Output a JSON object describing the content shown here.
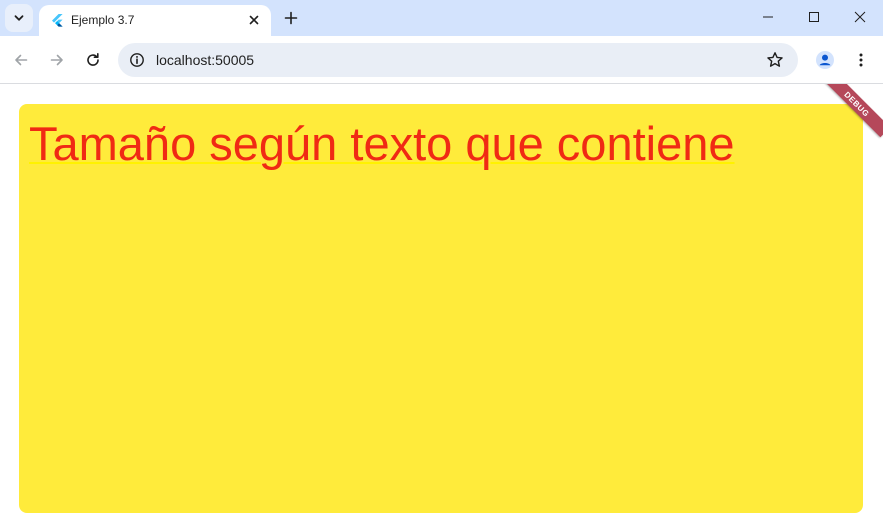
{
  "browser": {
    "tab": {
      "title": "Ejemplo 3.7"
    },
    "address_bar": {
      "url": "localhost:50005"
    },
    "icons": {
      "tab_search": "chevron-down-icon",
      "favicon": "flutter-icon",
      "close_tab": "close-icon",
      "new_tab": "plus-icon",
      "minimize": "minimize-icon",
      "maximize": "maximize-icon",
      "close_window": "close-icon",
      "back": "arrow-left-icon",
      "forward": "arrow-right-icon",
      "reload": "reload-icon",
      "site_info": "info-icon",
      "bookmark": "star-icon",
      "profile": "person-icon",
      "menu": "more-vert-icon"
    },
    "colors": {
      "tabstrip_bg": "#d3e3fd",
      "omnibox_bg": "#e9eef6"
    }
  },
  "page": {
    "box_text": "Tamaño según texto que contiene",
    "debug_banner": "DEBUG",
    "colors": {
      "box_bg": "#ffeb3b",
      "text": "#f02a14",
      "underline": "#fff200",
      "debug_banner": "#b5485a"
    }
  }
}
